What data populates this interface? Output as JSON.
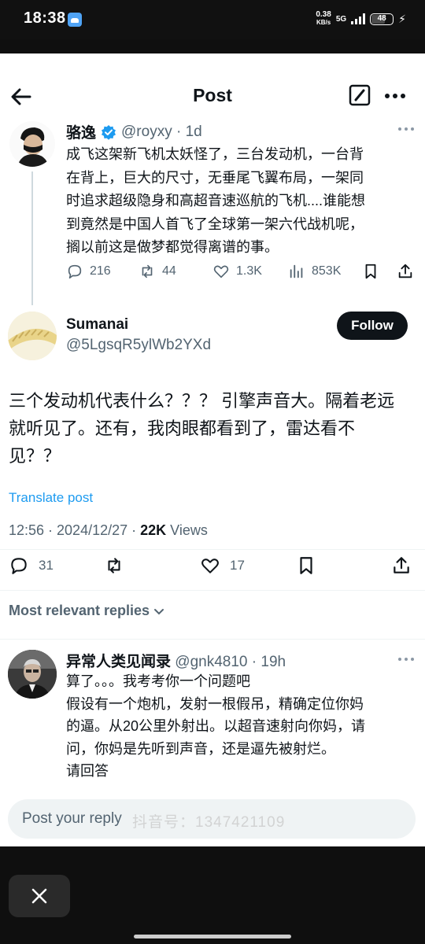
{
  "status_bar": {
    "time": "18:38",
    "net_speed_value": "0.38",
    "net_speed_unit": "KB/s",
    "network": "5G",
    "battery": "48"
  },
  "header": {
    "title": "Post"
  },
  "parent_post": {
    "author_name": "骆逸",
    "handle_time": "@royxy · 1d",
    "lines": [
      "成飞这架新飞机太妖怪了，三台发动机，一台背",
      "在背上，巨大的尺寸，无垂尾飞翼布局，一架同",
      "时追求超级隐身和高超音速巡航的飞机....谁能想",
      "到竟然是中国人首飞了全球第一架六代战机呢，",
      "搁以前这是做梦都觉得离谱的事。"
    ],
    "stats": {
      "replies": "216",
      "reposts": "44",
      "likes": "1.3K",
      "views": "853K"
    }
  },
  "main_post": {
    "author_name": "Sumanai",
    "handle": "@5LgsqR5ylWb2YXd",
    "follow_label": "Follow",
    "lines": [
      "三个发动机代表什么？？？ 引擎声音大。隔着老远",
      "就听见了。还有，我肉眼都看到了，雷达看不",
      "见？？"
    ],
    "translate_label": "Translate post",
    "timestamp": "12:56 · 2024/12/27 · ",
    "views_count": "22K",
    "views_label": " Views",
    "stats": {
      "replies": "31",
      "likes": "17"
    }
  },
  "replies_filter": "Most relevant replies",
  "comment": {
    "author_name": "异常人类见闻录",
    "handle_time": "@gnk4810 · 19h",
    "lines": [
      "算了。。。我考考你一个问题吧",
      "假设有一个炮机，发射一根假吊，精确定位你妈",
      "的逼。从20公里外射出。以超音速射向你妈，请",
      "问，你妈是先听到声音，还是逼先被射烂。",
      "请回答"
    ]
  },
  "reply_bar": {
    "placeholder": "Post your reply",
    "watermark": "抖音号：1347421109"
  },
  "colors": {
    "accent": "#1d9bf0",
    "text": "#0f1419",
    "secondary": "#536471",
    "follow_bg": "#0f1419"
  }
}
